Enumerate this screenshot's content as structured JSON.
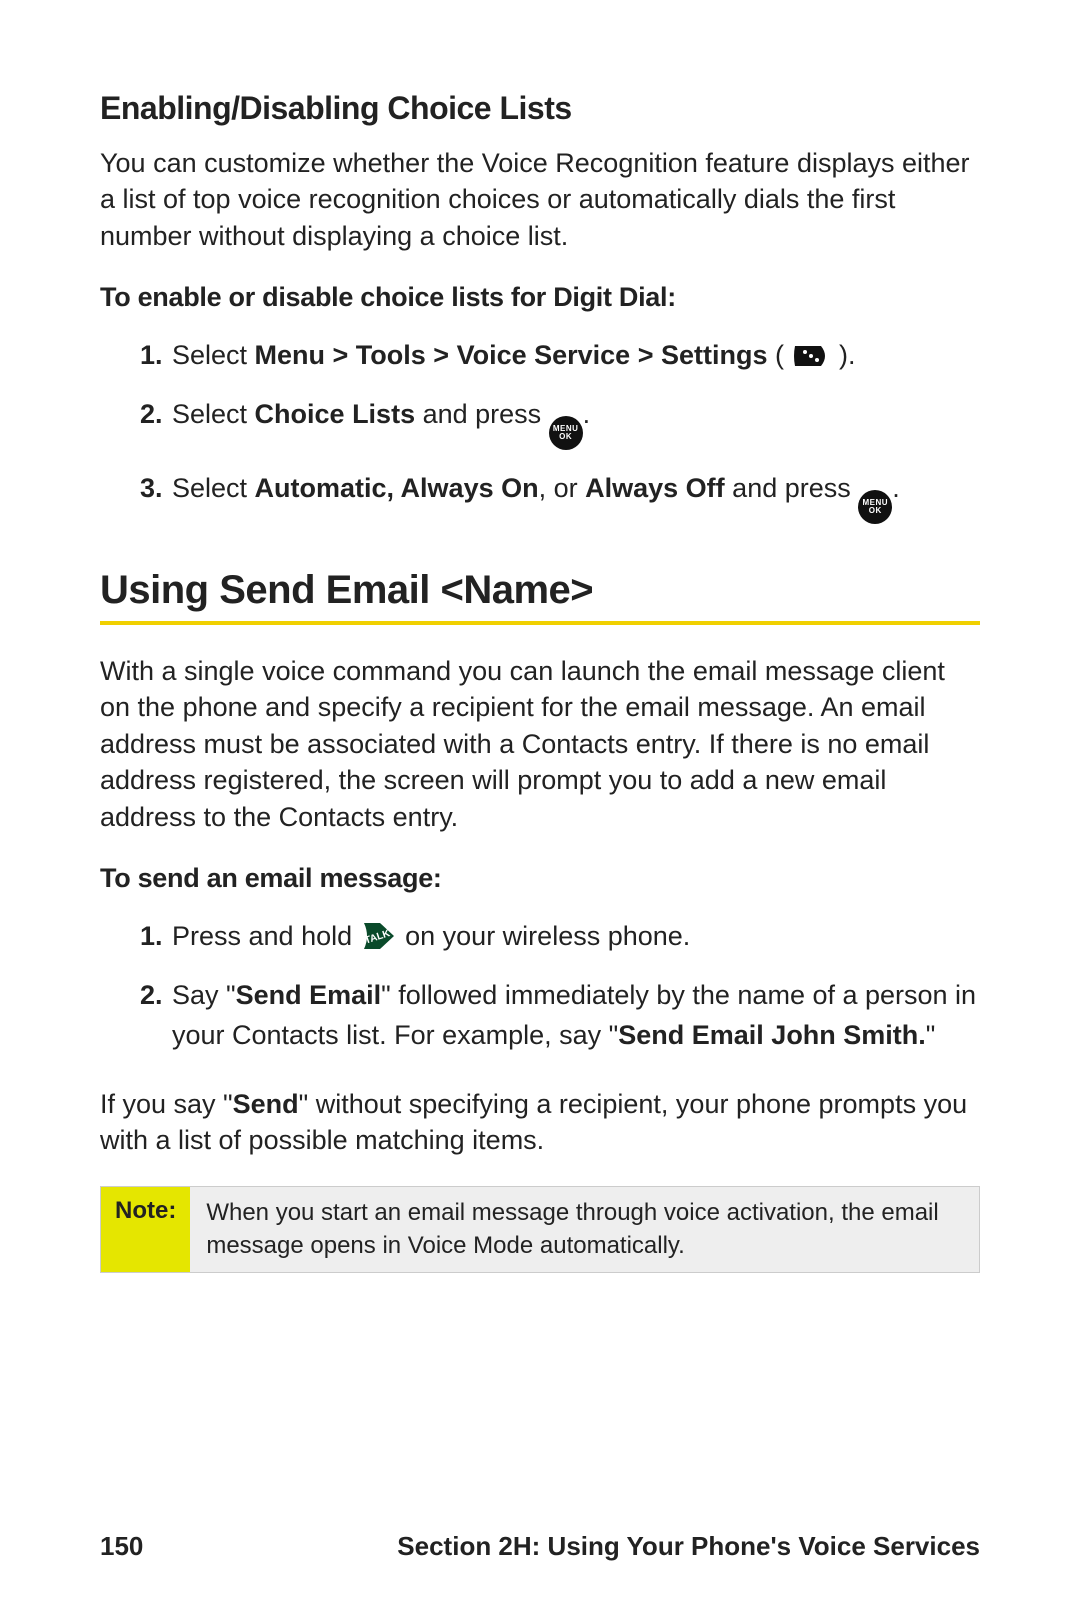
{
  "section1": {
    "heading": "Enabling/Disabling Choice Lists",
    "para": "You can customize whether the Voice Recognition feature displays either a list of top voice recognition choices or automatically dials the first number without displaying a choice list.",
    "lead": "To enable or disable choice lists for Digit Dial:",
    "steps": {
      "s1_a": "Select ",
      "s1_b": "Menu > Tools > Voice Service > Settings",
      "s1_c": " ( ",
      "s1_d": " ).",
      "s2_a": "Select ",
      "s2_b": "Choice Lists",
      "s2_c": " and press ",
      "s2_d": ".",
      "s3_a": "Select ",
      "s3_b": "Automatic, Always On",
      "s3_c": ", or ",
      "s3_d": "Always Off",
      "s3_e": " and press ",
      "s3_f": "."
    }
  },
  "section2": {
    "heading": "Using Send Email <Name>",
    "para": "With a single voice command you can launch the email message client on the phone and specify a recipient for the email message. An email address must be associated with a Contacts entry. If there is no email address registered, the screen will prompt you to add a new email address to the Contacts entry.",
    "lead": "To send an email message:",
    "steps": {
      "s1_a": "Press and hold ",
      "s1_b": " on your wireless phone.",
      "s2_a": "Say \"",
      "s2_b": "Send Email",
      "s2_c": "\" followed immediately by the name of a person in your Contacts list. For example, say \"",
      "s2_d": "Send Email John Smith.",
      "s2_e": "\""
    },
    "after": {
      "a": "If you say \"",
      "b": "Send",
      "c": "\" without specifying a recipient, your phone prompts you with a list of possible matching items."
    },
    "note_label": "Note:",
    "note_text": "When you start an email message through voice activation, the email message opens in Voice Mode automatically."
  },
  "footer": {
    "page": "150",
    "section": "Section 2H: Using Your Phone's Voice Services"
  }
}
